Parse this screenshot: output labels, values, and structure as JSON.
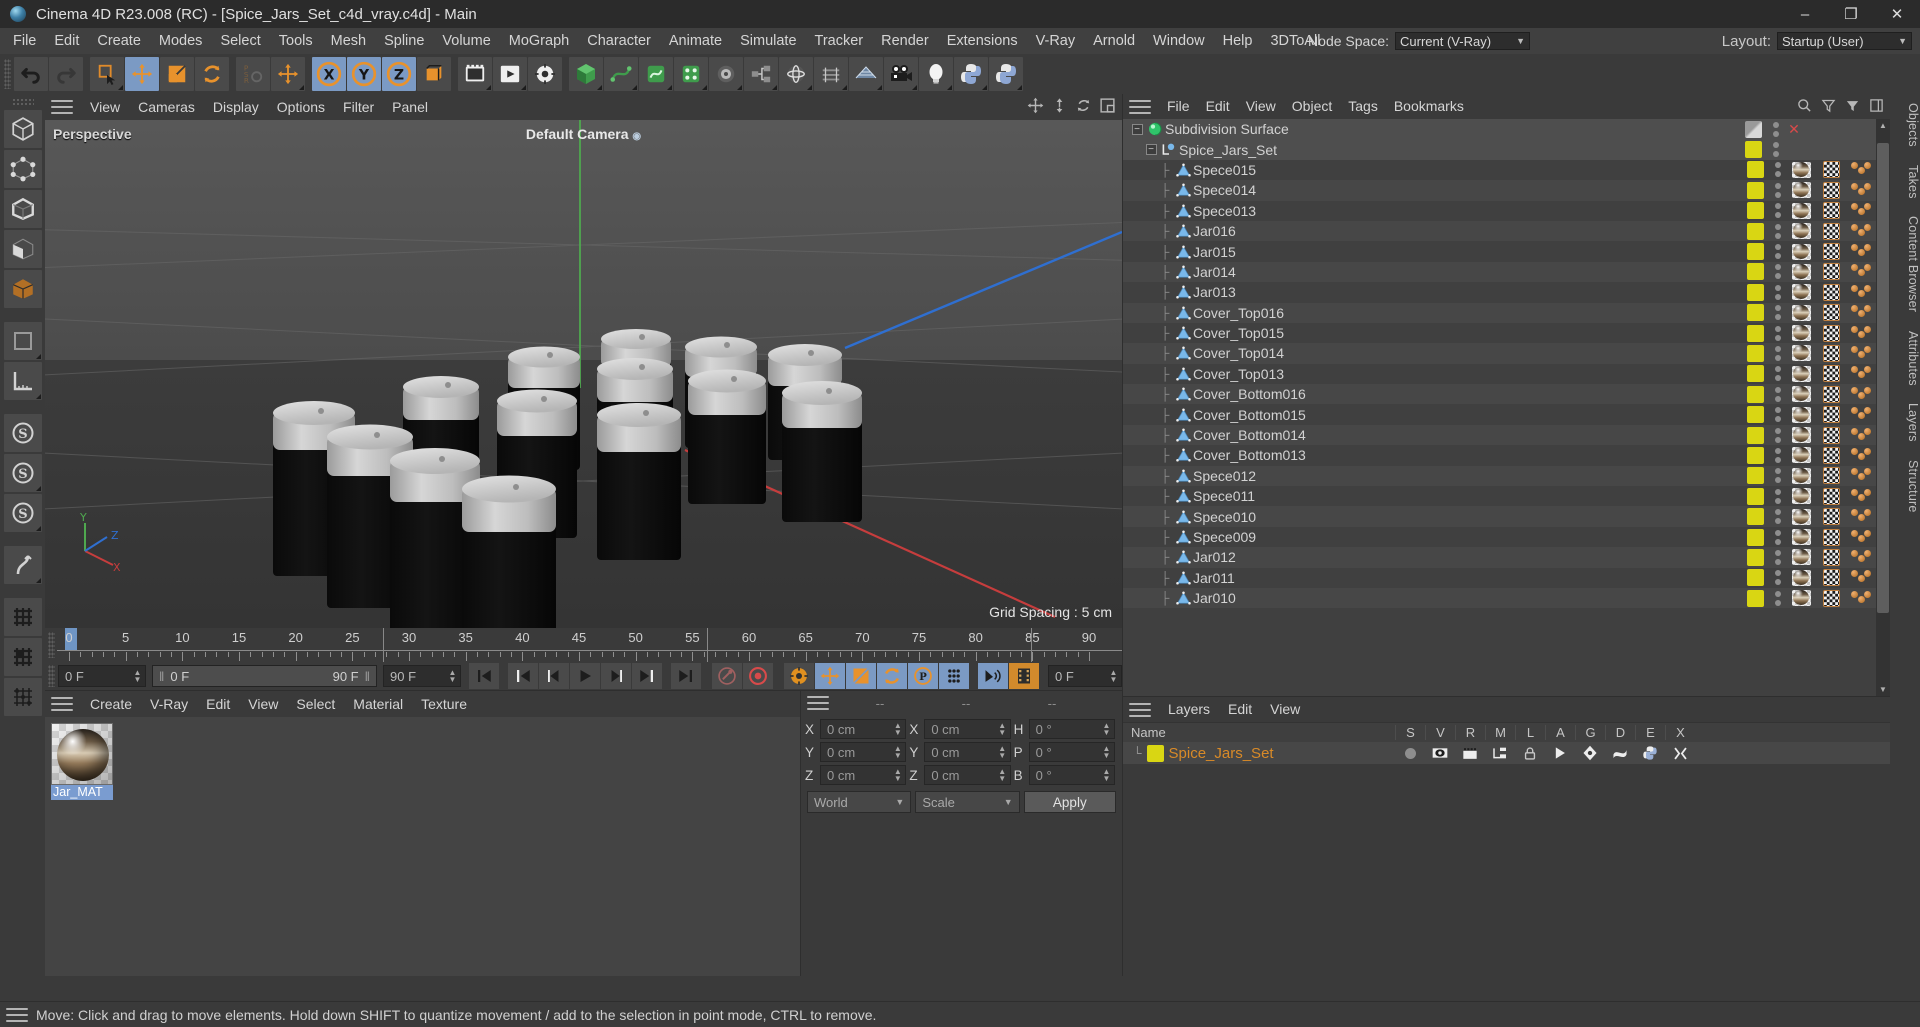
{
  "window": {
    "title": "Cinema 4D R23.008 (RC) - [Spice_Jars_Set_c4d_vray.c4d] - Main",
    "minimize": "–",
    "maximize": "❐",
    "close": "✕"
  },
  "menubar": {
    "items": [
      "File",
      "Edit",
      "Create",
      "Modes",
      "Select",
      "Tools",
      "Mesh",
      "Spline",
      "Volume",
      "MoGraph",
      "Character",
      "Animate",
      "Simulate",
      "Tracker",
      "Render",
      "Extensions",
      "V-Ray",
      "Arnold",
      "Window",
      "Help",
      "3DToAll"
    ],
    "node_space_label": "Node Space:",
    "node_space_value": "Current (V-Ray)",
    "layout_label": "Layout:",
    "layout_value": "Startup (User)"
  },
  "toolbar": {
    "icons": [
      "undo-icon",
      "redo-icon",
      "live-selection-icon",
      "move-icon",
      "scale-icon",
      "rotate-icon",
      "psr-icon",
      "move-dup-icon",
      "lock-x-icon",
      "lock-y-icon",
      "lock-z-icon",
      "world-coord-icon",
      "render-view-icon",
      "render-queue-icon",
      "render-settings-icon",
      "cube-icon",
      "spline-pen-icon",
      "nurbs-icon",
      "array-icon",
      "deformer-icon",
      "scene-nodes-icon",
      "mograph-icon",
      "field-icon",
      "mesh-grid-icon",
      "camera-icon",
      "light-icon",
      "python-icon",
      "python-gen-icon"
    ]
  },
  "left_toolbar": {
    "icons": [
      "cube-mode-icon",
      "points-mode-icon",
      "edges-mode-icon",
      "polygons-mode-icon",
      "model-mode-icon",
      "texture-mode-icon",
      "workplane-icon",
      "enable-axis-icon",
      "enable-snap-icon",
      "workplane-lock-icon",
      "bend-icon",
      "uv-mesh-icon",
      "uv-poly-icon",
      "uv-point-icon"
    ]
  },
  "viewport": {
    "menu": [
      "View",
      "Cameras",
      "Display",
      "Options",
      "Filter",
      "Panel"
    ],
    "label": "Perspective",
    "camera": "Default Camera",
    "grid_spacing": "Grid Spacing : 5 cm",
    "axis": {
      "x": "X",
      "y": "Y",
      "z": "Z"
    },
    "header_icons": [
      "pan-icon",
      "dolly-icon",
      "rotate-view-icon",
      "maximize-view-icon"
    ]
  },
  "timeline": {
    "ticks": [
      "0",
      "5",
      "10",
      "15",
      "20",
      "25",
      "30",
      "35",
      "40",
      "45",
      "50",
      "55",
      "60",
      "65",
      "70",
      "75",
      "80",
      "85",
      "90"
    ],
    "current_frame": "0 F",
    "range_start": "0 F",
    "range_end": "90 F",
    "end_frame": "90 F",
    "preview_frame": "0 F",
    "transport": [
      "go-to-start-icon",
      "go-to-prev-key-icon",
      "step-back-icon",
      "play-icon",
      "step-forward-icon",
      "go-to-next-key-icon",
      "go-to-end-icon"
    ],
    "record_tools": [
      "autokey-icon",
      "record-icon",
      "keyframe-settings-icon",
      "key-position-icon",
      "key-scale-icon",
      "key-rotation-icon",
      "key-param-icon",
      "key-points-icon",
      "sound-icon",
      "timeline-icon"
    ]
  },
  "material_manager": {
    "menu": [
      "Create",
      "V-Ray",
      "Edit",
      "View",
      "Select",
      "Material",
      "Texture"
    ],
    "materials": [
      {
        "name": "Jar_MAT",
        "selected": true
      }
    ]
  },
  "coordinates": {
    "header": [
      "--",
      "--",
      "--"
    ],
    "rows": [
      {
        "pos_label": "X",
        "pos_value": "0 cm",
        "size_label": "X",
        "size_value": "0 cm",
        "rot_label": "H",
        "rot_value": "0 °"
      },
      {
        "pos_label": "Y",
        "pos_value": "0 cm",
        "size_label": "Y",
        "size_value": "0 cm",
        "rot_label": "P",
        "rot_value": "0 °"
      },
      {
        "pos_label": "Z",
        "pos_value": "0 cm",
        "size_label": "Z",
        "size_value": "0 cm",
        "rot_label": "B",
        "rot_value": "0 °"
      }
    ],
    "system": "World",
    "mode": "Scale",
    "apply": "Apply"
  },
  "object_manager": {
    "menu": [
      "File",
      "Edit",
      "View",
      "Object",
      "Tags",
      "Bookmarks"
    ],
    "header_icons": [
      "search-icon",
      "filter-up-icon",
      "filter-icon",
      "columns-icon"
    ],
    "layer_color": "#d9d613",
    "rows": [
      {
        "name": "Subdivision Surface",
        "icon": "subdivision-surface-icon",
        "depth": 0,
        "expander": true,
        "layer": false,
        "tags": false,
        "close": true
      },
      {
        "name": "Spice_Jars_Set",
        "icon": "null-object-icon",
        "depth": 1,
        "expander": true,
        "layer": true,
        "tags": false
      },
      {
        "name": "Spece015",
        "icon": "polygon-object-icon",
        "depth": 2,
        "layer": true,
        "tags": true
      },
      {
        "name": "Spece014",
        "icon": "polygon-object-icon",
        "depth": 2,
        "layer": true,
        "tags": true
      },
      {
        "name": "Spece013",
        "icon": "polygon-object-icon",
        "depth": 2,
        "layer": true,
        "tags": true
      },
      {
        "name": "Jar016",
        "icon": "polygon-object-icon",
        "depth": 2,
        "layer": true,
        "tags": true
      },
      {
        "name": "Jar015",
        "icon": "polygon-object-icon",
        "depth": 2,
        "layer": true,
        "tags": true
      },
      {
        "name": "Jar014",
        "icon": "polygon-object-icon",
        "depth": 2,
        "layer": true,
        "tags": true
      },
      {
        "name": "Jar013",
        "icon": "polygon-object-icon",
        "depth": 2,
        "layer": true,
        "tags": true
      },
      {
        "name": "Cover_Top016",
        "icon": "polygon-object-icon",
        "depth": 2,
        "layer": true,
        "tags": true
      },
      {
        "name": "Cover_Top015",
        "icon": "polygon-object-icon",
        "depth": 2,
        "layer": true,
        "tags": true
      },
      {
        "name": "Cover_Top014",
        "icon": "polygon-object-icon",
        "depth": 2,
        "layer": true,
        "tags": true
      },
      {
        "name": "Cover_Top013",
        "icon": "polygon-object-icon",
        "depth": 2,
        "layer": true,
        "tags": true
      },
      {
        "name": "Cover_Bottom016",
        "icon": "polygon-object-icon",
        "depth": 2,
        "layer": true,
        "tags": true
      },
      {
        "name": "Cover_Bottom015",
        "icon": "polygon-object-icon",
        "depth": 2,
        "layer": true,
        "tags": true
      },
      {
        "name": "Cover_Bottom014",
        "icon": "polygon-object-icon",
        "depth": 2,
        "layer": true,
        "tags": true
      },
      {
        "name": "Cover_Bottom013",
        "icon": "polygon-object-icon",
        "depth": 2,
        "layer": true,
        "tags": true
      },
      {
        "name": "Spece012",
        "icon": "polygon-object-icon",
        "depth": 2,
        "layer": true,
        "tags": true
      },
      {
        "name": "Spece011",
        "icon": "polygon-object-icon",
        "depth": 2,
        "layer": true,
        "tags": true
      },
      {
        "name": "Spece010",
        "icon": "polygon-object-icon",
        "depth": 2,
        "layer": true,
        "tags": true
      },
      {
        "name": "Spece009",
        "icon": "polygon-object-icon",
        "depth": 2,
        "layer": true,
        "tags": true
      },
      {
        "name": "Jar012",
        "icon": "polygon-object-icon",
        "depth": 2,
        "layer": true,
        "tags": true
      },
      {
        "name": "Jar011",
        "icon": "polygon-object-icon",
        "depth": 2,
        "layer": true,
        "tags": true
      },
      {
        "name": "Jar010",
        "icon": "polygon-object-icon",
        "depth": 2,
        "layer": true,
        "tags": true
      }
    ]
  },
  "layers_panel": {
    "menu": [
      "Layers",
      "Edit",
      "View"
    ],
    "columns": [
      "Name",
      "S",
      "V",
      "R",
      "M",
      "L",
      "A",
      "G",
      "D",
      "E",
      "X"
    ],
    "rows": [
      {
        "name": "Spice_Jars_Set",
        "color": "#d9d613"
      }
    ],
    "row_icons": [
      "solo-dot-icon",
      "eye-icon",
      "render-icon",
      "manager-icon",
      "lock-icon",
      "animation-icon",
      "generator-icon",
      "deformer-icon",
      "expression-icon",
      "xref-icon"
    ]
  },
  "right_tabs": [
    "Objects",
    "Takes",
    "Content Browser",
    "Attributes",
    "Layers",
    "Structure"
  ],
  "statusbar": {
    "text": "Move: Click and drag to move elements. Hold down SHIFT to quantize movement / add to the selection in point mode, CTRL to remove."
  }
}
